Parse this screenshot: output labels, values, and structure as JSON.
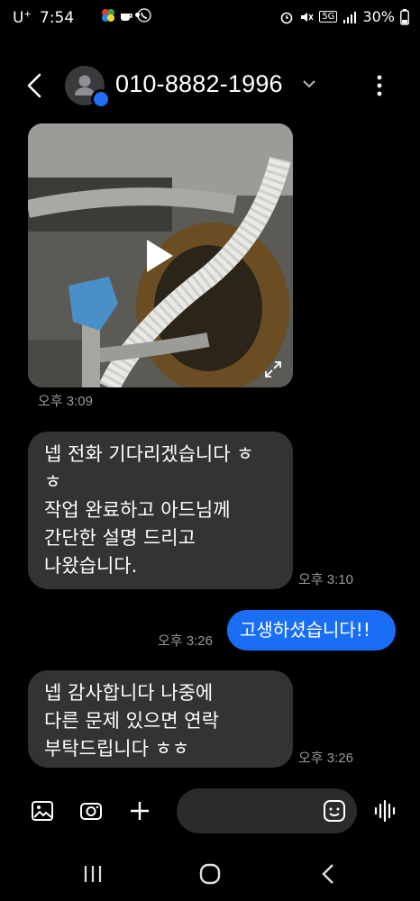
{
  "status_bar": {
    "carrier": "U",
    "carrier_sup": "+",
    "time": "7:54",
    "network": "5G",
    "battery": "30%"
  },
  "header": {
    "contact": "010-8882-1996",
    "icons": [
      "back-arrow-icon",
      "avatar-icon",
      "chevron-down-icon",
      "more-vert-icon"
    ]
  },
  "messages": [
    {
      "type": "video",
      "direction": "in",
      "time": "오후 3:09"
    },
    {
      "type": "text",
      "direction": "in",
      "lines": [
        "넵 전화 기다리겠습니다 ㅎ",
        "ㅎ",
        "작업 완료하고 아드님께",
        "간단한 설명 드리고",
        "나왔습니다."
      ],
      "time": "오후 3:10"
    },
    {
      "type": "text",
      "direction": "out",
      "text": "고생하셨습니다!!",
      "time": "오후 3:26"
    },
    {
      "type": "text",
      "direction": "in",
      "lines": [
        "넵 감사합니다 나중에",
        "다른 문제 있으면 연락",
        "부탁드립니다 ㅎㅎ"
      ],
      "time": "오후 3:26"
    }
  ],
  "composer": {
    "icons": [
      "gallery-icon",
      "camera-icon",
      "plus-icon",
      "emoji-icon",
      "voice-icon"
    ]
  },
  "colors": {
    "background": "#000000",
    "incoming_bubble": "#333335",
    "outgoing_bubble": "#1a6ef5",
    "timestamp": "#9a9a9a"
  }
}
